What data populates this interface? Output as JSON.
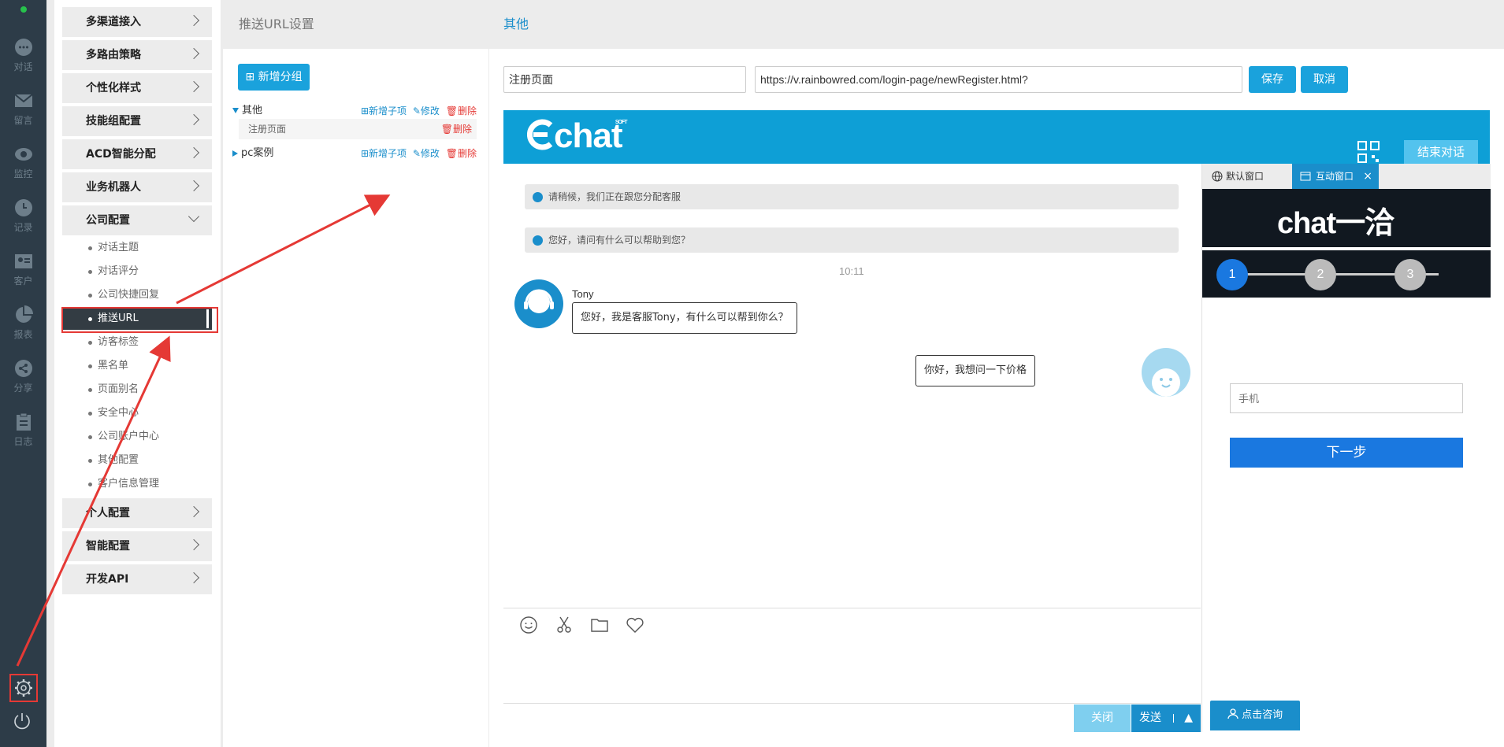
{
  "rail": {
    "items": [
      {
        "label": "对话",
        "icon": "chat-bubble-icon"
      },
      {
        "label": "留言",
        "icon": "envelope-icon"
      },
      {
        "label": "监控",
        "icon": "eye-icon"
      },
      {
        "label": "记录",
        "icon": "clock-icon"
      },
      {
        "label": "客户",
        "icon": "contact-card-icon"
      },
      {
        "label": "报表",
        "icon": "pie-chart-icon"
      },
      {
        "label": "分享",
        "icon": "share-icon"
      },
      {
        "label": "日志",
        "icon": "clipboard-icon"
      }
    ]
  },
  "menu": {
    "sections_top": [
      "多渠道接入",
      "多路由策略",
      "个性化样式",
      "技能组配置",
      "ACD智能分配",
      "业务机器人",
      "公司配置"
    ],
    "company_sub": [
      "对话主题",
      "对话评分",
      "公司快捷回复",
      "推送URL",
      "访客标签",
      "黑名单",
      "页面别名",
      "安全中心",
      "公司账户中心",
      "其他配置",
      "客户信息管理"
    ],
    "sections_bottom": [
      "个人配置",
      "智能配置",
      "开发API"
    ]
  },
  "groups": {
    "title": "推送URL设置",
    "add_label": "新增分组",
    "rows": [
      {
        "name": "其他",
        "add": "新增子项",
        "edit": "修改",
        "del": "删除"
      },
      {
        "name": "pc案例",
        "add": "新增子项",
        "edit": "修改",
        "del": "删除"
      }
    ],
    "child": {
      "name": "注册页面",
      "del": "删除"
    }
  },
  "detail": {
    "title": "其他",
    "name_value": "注册页面",
    "url_value": "https://v.rainbowred.com/login-page/newRegister.html?",
    "save_label": "保存",
    "cancel_label": "取消"
  },
  "preview": {
    "logo": "chat",
    "logo_sup": "SOFT",
    "end_label": "结束对话",
    "sys_msgs": [
      "请稍候，我们正在跟您分配客服",
      "您好，请问有什么可以帮助到您？"
    ],
    "time": "10:11",
    "agent_name": "Tony",
    "agent_msg": "您好，我是客服Tony，有什么可以帮到你么？",
    "user_msg": "你好，我想问一下价格",
    "close_label": "关闭",
    "send_label": "发送",
    "send_arrow": "▲",
    "tabs": [
      "默认窗口",
      "互动窗口"
    ],
    "tab_close": "×",
    "banner": "chat一洽",
    "steps": [
      "1",
      "2",
      "3"
    ],
    "phone_placeholder": "手机",
    "next_label": "下一步",
    "consult_label": "点击咨询"
  },
  "colors": {
    "accent": "#1aa2dc",
    "rail_bg": "#2d3c48",
    "annotation_red": "#e53935"
  }
}
